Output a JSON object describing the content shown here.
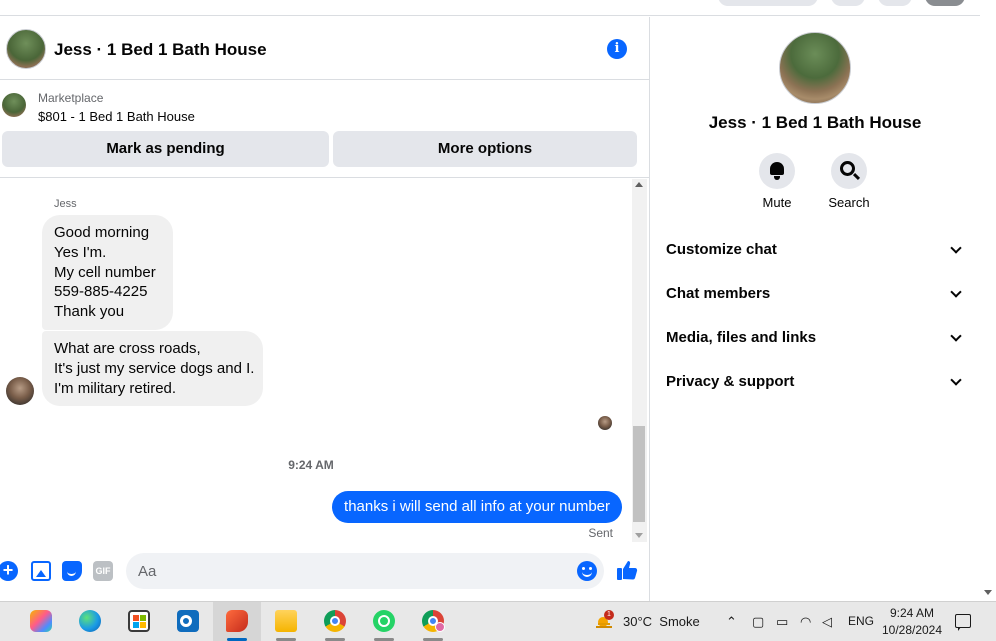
{
  "chat": {
    "title": "Jess · 1 Bed 1 Bath House",
    "listing": {
      "source": "Marketplace",
      "name": "$801 - 1 Bed 1 Bath House"
    },
    "buttons": {
      "pending": "Mark as pending",
      "more": "More options"
    },
    "messages": {
      "sender": "Jess",
      "incoming_1": "Good morning\nYes I'm.\nMy cell number\n559-885-4225\nThank you",
      "incoming_2": "What are cross roads,\nIt's just my service dogs and I.\nI'm military retired.",
      "timestamp": "9:24 AM",
      "outgoing": "thanks i will send all info at your number",
      "status": "Sent"
    },
    "composer": {
      "placeholder": "Aa",
      "gif_label": "GIF"
    }
  },
  "info_panel": {
    "name": "Jess · 1 Bed 1 Bath House",
    "actions": [
      {
        "label": "Mute",
        "icon": "bell-icon"
      },
      {
        "label": "Search",
        "icon": "search-icon"
      }
    ],
    "sections": [
      "Customize chat",
      "Chat members",
      "Media, files and links",
      "Privacy & support"
    ]
  },
  "taskbar": {
    "weather": {
      "temp": "30°C",
      "condition": "Smoke",
      "badge": "1"
    },
    "language": "ENG",
    "time": "9:24 AM",
    "date": "10/28/2024",
    "apps": [
      "copilot-icon",
      "edge-icon",
      "store-icon",
      "outlook-icon",
      "paint-icon",
      "file-explorer-icon",
      "chrome-icon",
      "whatsapp-icon",
      "chrome-profile-icon"
    ]
  },
  "colors": {
    "accent": "#0866ff",
    "bubble_in": "#f0f0f0",
    "button_bg": "#e4e6eb",
    "secondary_text": "#65676b"
  }
}
